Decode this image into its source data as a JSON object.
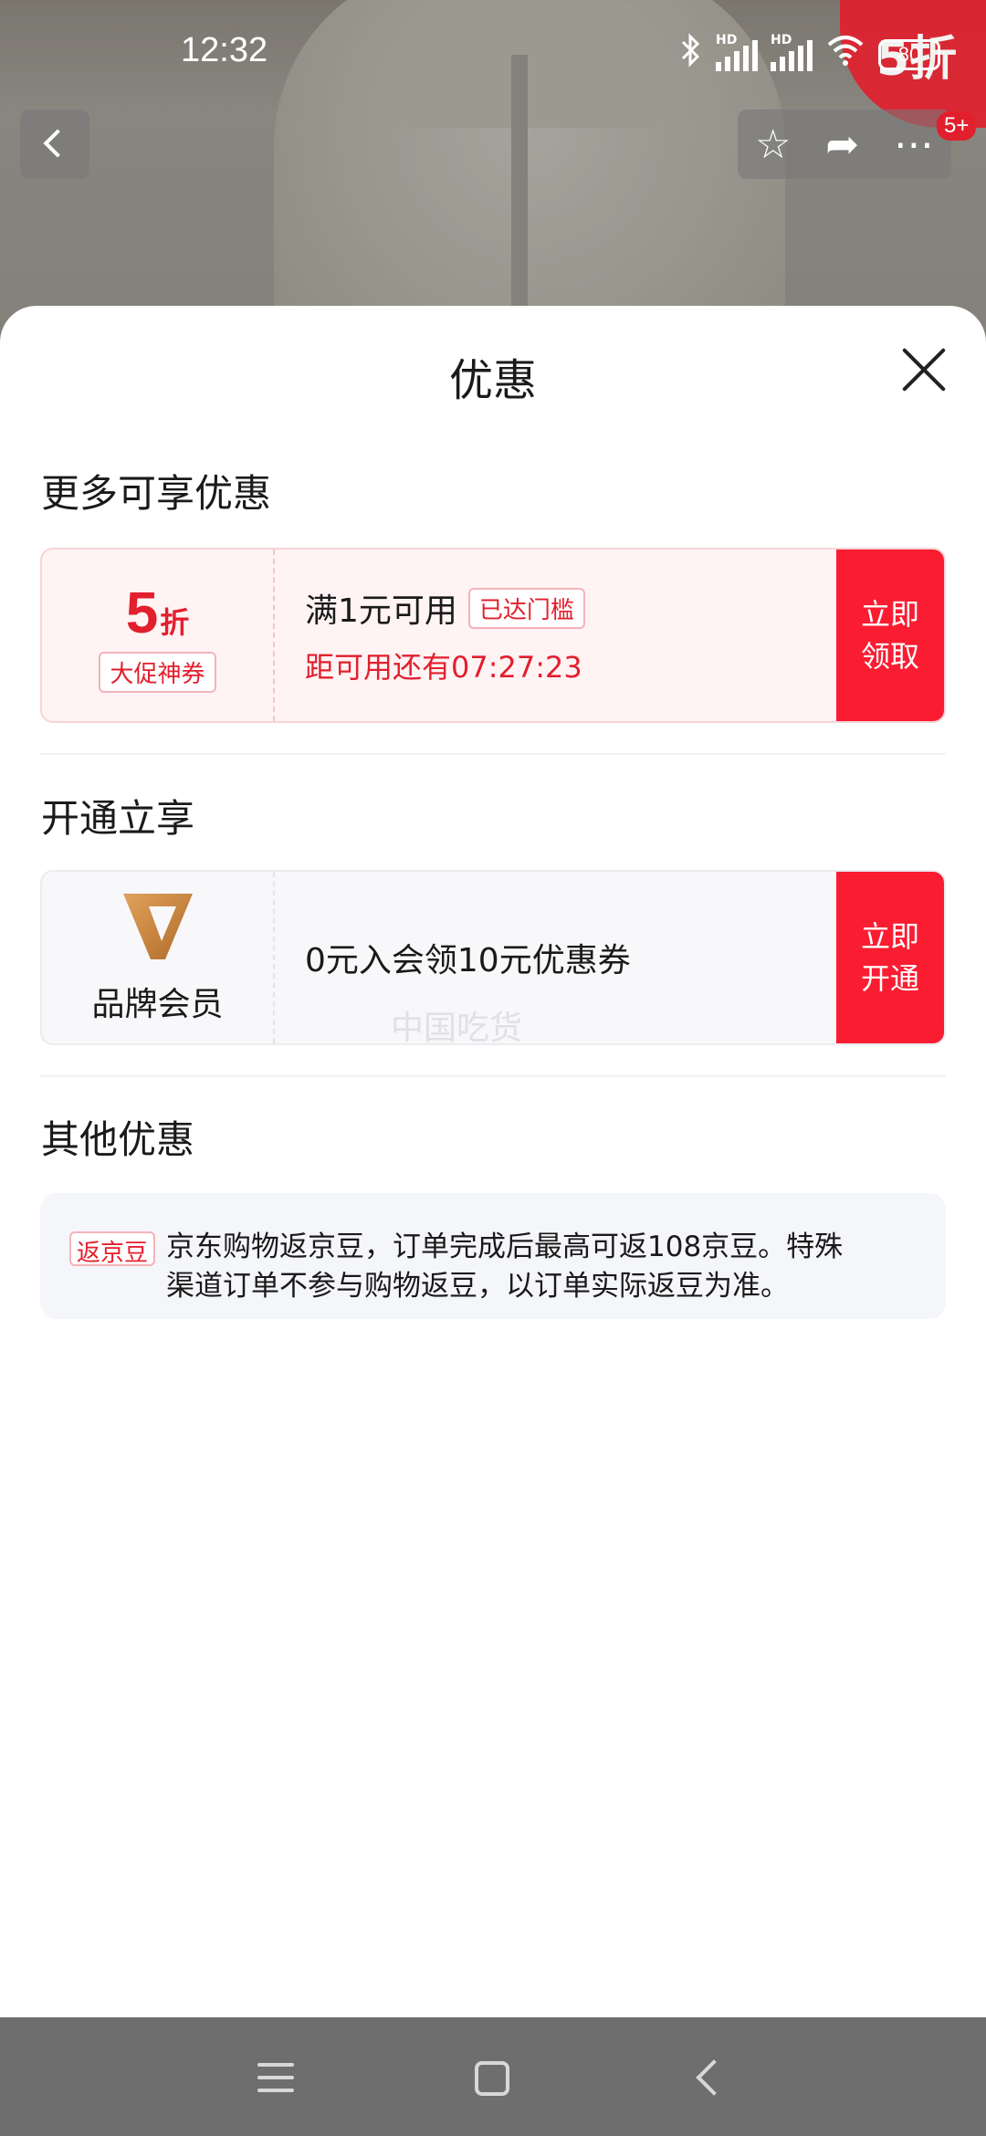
{
  "status_bar": {
    "time": "12:32",
    "battery": "80",
    "hd1": "HD",
    "hd2": "HD"
  },
  "background": {
    "promo_badge": "5折",
    "cart_count": "5+",
    "icons": [
      "back-icon",
      "star-icon",
      "share-icon",
      "more-icon"
    ]
  },
  "sheet": {
    "title": "优惠",
    "section_more": "更多可享优惠",
    "coupon": {
      "discount_number": "5",
      "discount_unit": "折",
      "badge": "大促神券",
      "threshold": "满1元可用",
      "status_tag": "已达门槛",
      "countdown": "距可用还有07:27:23",
      "button_line1": "立即",
      "button_line2": "领取"
    },
    "section_open": "开通立享",
    "membership": {
      "logo_icon": "brand-v-logo-icon",
      "label": "品牌会员",
      "offer": "0元入会领10元优惠券",
      "button_line1": "立即",
      "button_line2": "开通"
    },
    "watermark": "中国吃货",
    "section_other": "其他优惠",
    "other": {
      "tag": "返京豆",
      "text": "京东购物返京豆，订单完成后最高可返108京豆。特殊渠道订单不参与购物返豆，以订单实际返豆为准。"
    }
  },
  "colors": {
    "accent_red": "#fa1d32",
    "text_red": "#e21f2d",
    "brand_gold": "#c98a3a"
  }
}
